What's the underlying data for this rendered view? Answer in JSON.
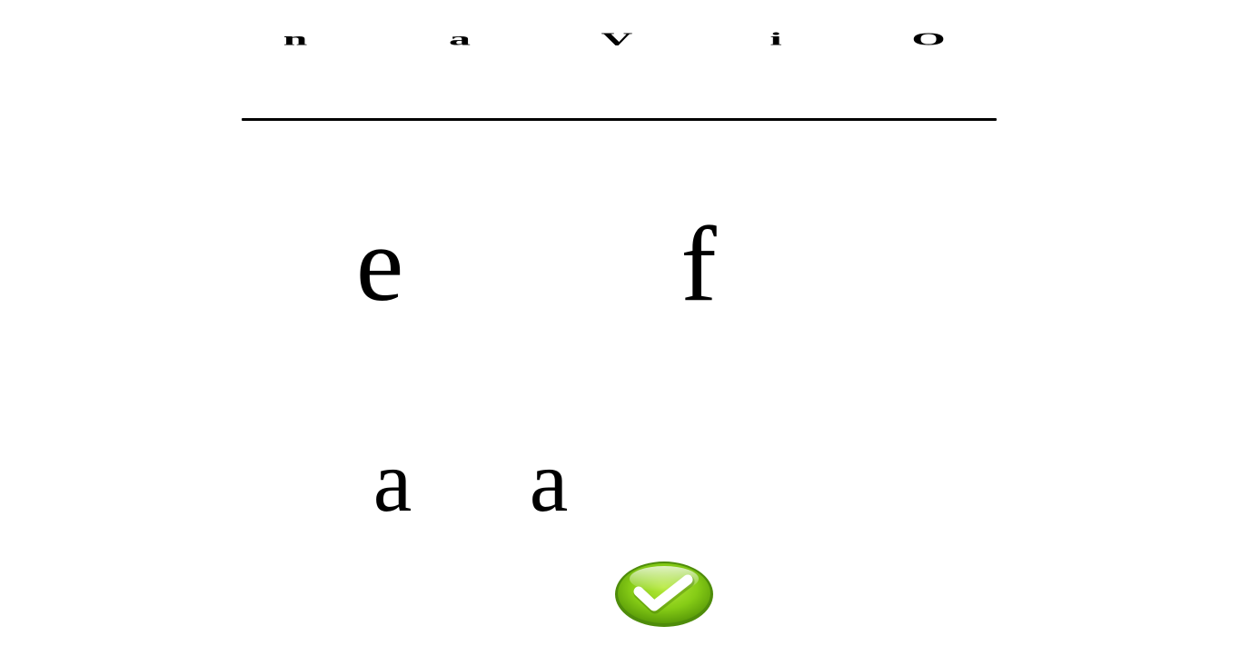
{
  "target_word": {
    "letters": [
      "n",
      "a",
      "V",
      "i",
      "O"
    ]
  },
  "letter_tiles": [
    {
      "letter": "e"
    },
    {
      "letter": "f"
    },
    {
      "letter": "a"
    },
    {
      "letter": "a"
    }
  ],
  "check_button": {
    "icon": "check-icon",
    "color": "#7cc518"
  },
  "colors": {
    "background": "#ffffff",
    "text": "#000000",
    "accent_green": "#7cc518",
    "accent_green_dark": "#4e8c0a"
  }
}
